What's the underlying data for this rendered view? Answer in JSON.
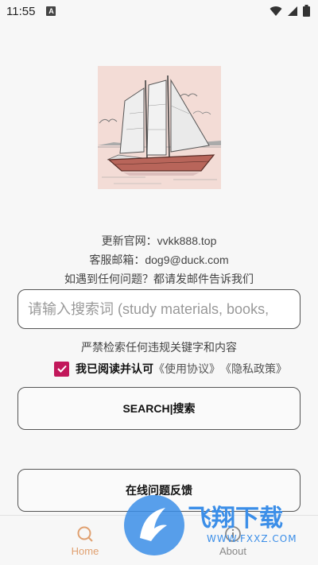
{
  "status_bar": {
    "time": "11:55",
    "notification_icon": "a-icon"
  },
  "info": {
    "website": "更新官网：vvkk888.top",
    "email": "客服邮箱：dog9@duck.com",
    "contact": "如遇到任何问题？都请发邮件告诉我们"
  },
  "search": {
    "placeholder": "请输入搜索词 (study materials, books,"
  },
  "warning": "严禁检索任何违规关键字和内容",
  "agreement": {
    "checked": true,
    "label": "我已阅读并认可",
    "terms_link": "《使用协议》",
    "privacy_link": "《隐私政策》"
  },
  "buttons": {
    "search": "SEARCH|搜索",
    "feedback": "在线问题反馈"
  },
  "bottom_nav": {
    "items": [
      {
        "label": "Home",
        "icon": "search-icon",
        "active": true
      },
      {
        "label": "About",
        "icon": "info-icon",
        "active": false
      }
    ]
  },
  "watermark": {
    "text": "飞翔下载",
    "url_text": "WWW.FXXZ.COM"
  },
  "colors": {
    "accent": "#e0a070",
    "checkbox": "#c2185b",
    "watermark": "#3b8ee8"
  }
}
